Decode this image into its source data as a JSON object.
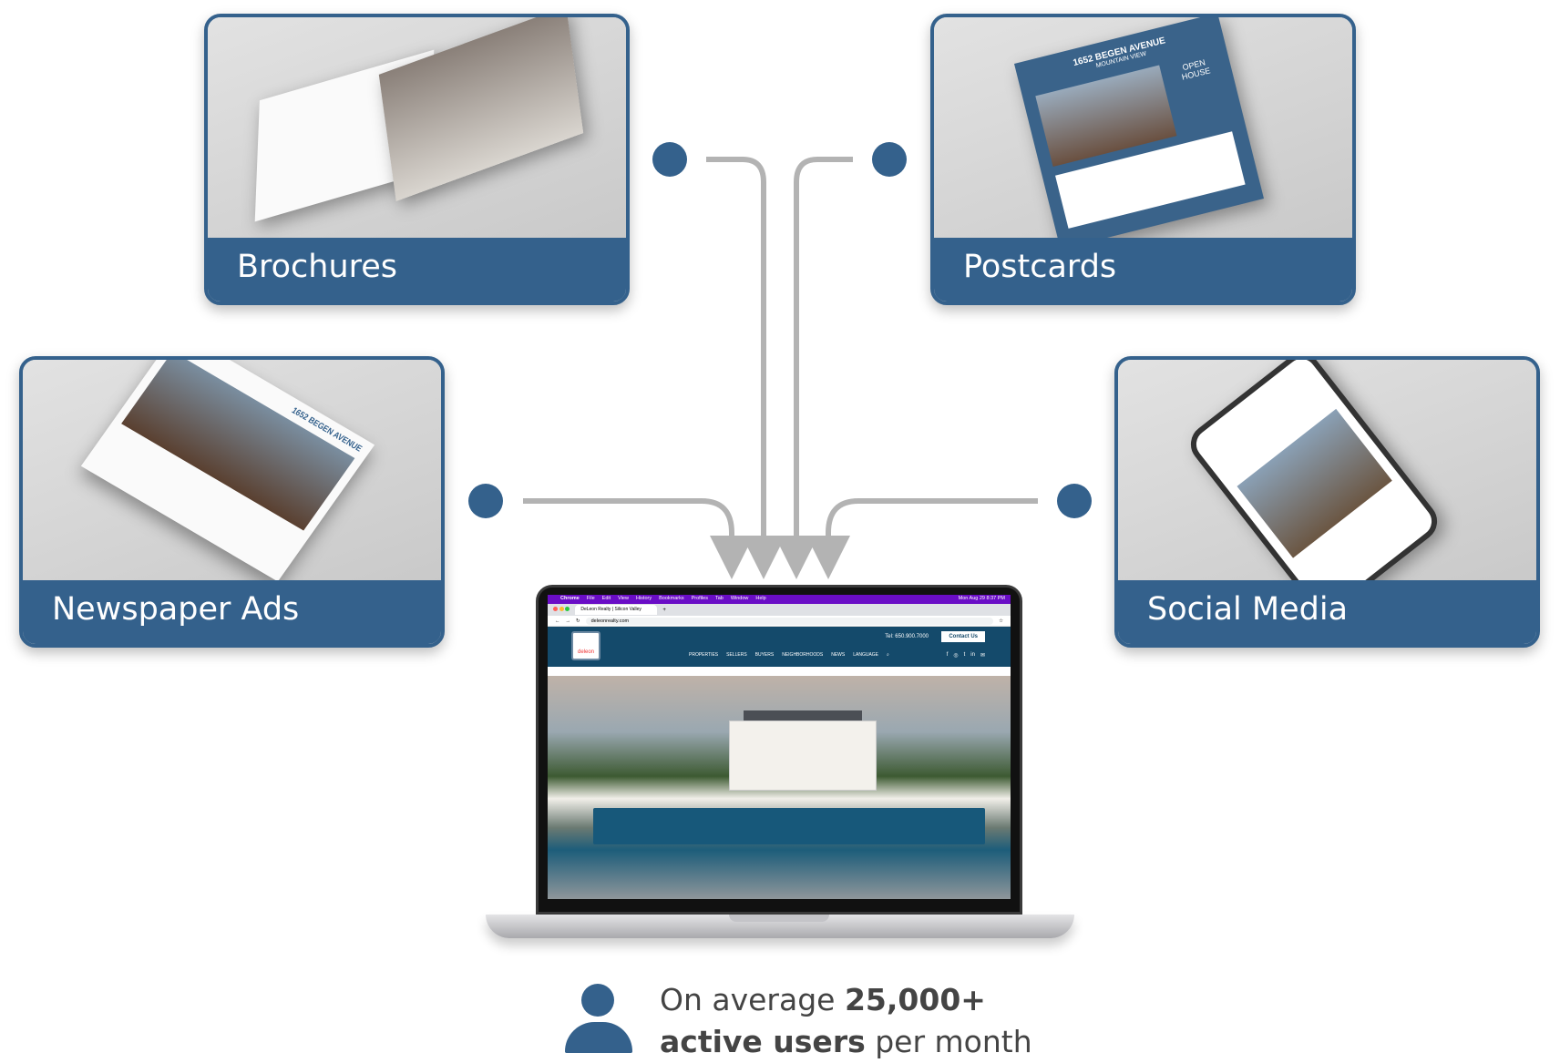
{
  "cards": [
    {
      "label": "Brochures"
    },
    {
      "label": "Postcards",
      "doc_heading": "1652 BEGEN AVENUE",
      "doc_sub": "MOUNTAIN VIEW",
      "doc_badge": "OPEN HOUSE"
    },
    {
      "label": "Newspaper Ads",
      "doc_heading": "1652 BEGEN AVENUE"
    },
    {
      "label": "Social Media"
    }
  ],
  "laptop": {
    "menubar": [
      "Chrome",
      "File",
      "Edit",
      "View",
      "History",
      "Bookmarks",
      "Profiles",
      "Tab",
      "Window",
      "Help"
    ],
    "clock": "Mon Aug 29 8:37 PM",
    "tab_title": "DeLeon Realty | Silicon Valley",
    "url": "deleonrealty.com",
    "logo_text": "deleon",
    "tel": "Tel: 650.900.7000",
    "contact": "Contact Us",
    "nav": [
      "PROPERTIES",
      "SELLERS",
      "BUYERS",
      "NEIGHBORHOODS",
      "NEWS",
      "LANGUAGE"
    ],
    "social": [
      "f",
      "◎",
      "t",
      "in",
      "✉"
    ]
  },
  "stat": {
    "prefix": "On average ",
    "count": "25,000+",
    "bold2": "active users",
    "suffix": " per month"
  },
  "colors": {
    "brand": "#34618c",
    "connector": "#b3b3b3",
    "menubar": "#6a0dc6",
    "site_header": "#144a6b"
  }
}
